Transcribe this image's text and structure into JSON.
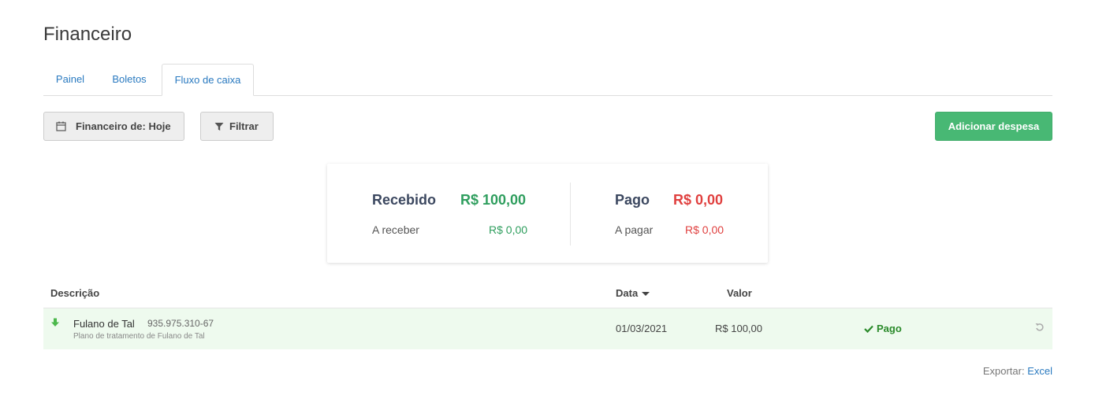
{
  "page": {
    "title": "Financeiro"
  },
  "tabs": [
    {
      "label": "Painel"
    },
    {
      "label": "Boletos"
    },
    {
      "label": "Fluxo de caixa",
      "active": true
    }
  ],
  "toolbar": {
    "date_filter_label": "Financeiro de: Hoje",
    "filter_label": "Filtrar",
    "add_expense_label": "Adicionar despesa",
    "date_filter_icon": "calendar-icon",
    "filter_icon": "funnel-icon"
  },
  "summary": {
    "received": {
      "label": "Recebido",
      "amount": "R$ 100,00",
      "sub_label": "A receber",
      "sub_amount": "R$ 0,00"
    },
    "paid": {
      "label": "Pago",
      "amount": "R$ 0,00",
      "sub_label": "A pagar",
      "sub_amount": "R$ 0,00"
    }
  },
  "table": {
    "columns": {
      "description": "Descrição",
      "date": "Data",
      "value": "Valor"
    },
    "rows": [
      {
        "direction_icon": "arrow-down-icon",
        "name": "Fulano de Tal",
        "document": "935.975.310-67",
        "description": "Plano de tratamento de Fulano de Tal",
        "date": "01/03/2021",
        "value": "R$ 100,00",
        "status": "Pago",
        "status_icon": "check-icon",
        "action_icon": "undo-icon"
      }
    ]
  },
  "export": {
    "label": "Exportar:",
    "excel": "Excel"
  },
  "colors": {
    "accent_blue": "#2a7ac0",
    "success_green": "#48b874",
    "received_green": "#2f9e5e",
    "paid_red": "#e0403f",
    "row_bg": "#eefaee"
  }
}
